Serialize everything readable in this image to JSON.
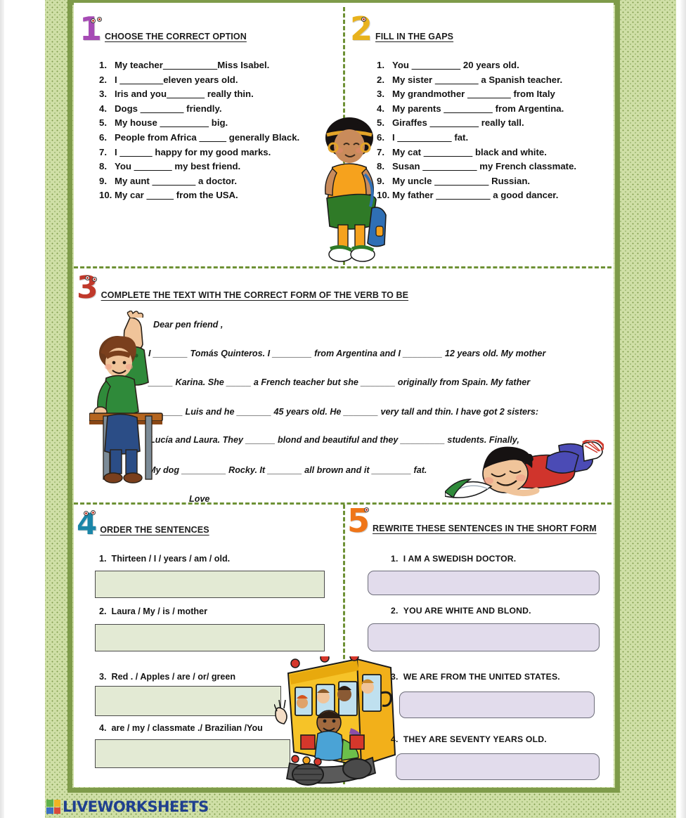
{
  "page": {
    "background_color": "#cfdfa6",
    "border_color": "#7e9b4a",
    "paper_color": "#ffffff",
    "separator_color": "#6e9135"
  },
  "exercises": [
    {
      "number": "1",
      "number_color": "#a64bb5",
      "title": "CHOOSE THE CORRECT OPTION",
      "items": [
        {
          "n": "1.",
          "pre": "My teacher",
          "blank": "__________",
          "post": "Miss Isabel."
        },
        {
          "n": "2.",
          "pre": "I  ",
          "blank": "________",
          "post": "eleven years old."
        },
        {
          "n": "3.",
          "pre": "Iris and you",
          "blank": "_______",
          "post": " really thin."
        },
        {
          "n": "4.",
          "pre": "Dogs ",
          "blank": "________",
          "post": " friendly."
        },
        {
          "n": "5.",
          "pre": "My house ",
          "blank": "_________",
          "post": " big."
        },
        {
          "n": "6.",
          "pre": "People from Africa ",
          "blank": "_____",
          "post": " generally Black."
        },
        {
          "n": "7.",
          "pre": "I ",
          "blank": "______",
          "post": " happy for my good marks."
        },
        {
          "n": "8.",
          "pre": "You ",
          "blank": "_______",
          "post": " my best friend."
        },
        {
          "n": "9.",
          "pre": "My aunt ",
          "blank": "________",
          "post": " a doctor."
        },
        {
          "n": "10.",
          "pre": "My car ",
          "blank": "_____",
          "post": " from the USA."
        }
      ]
    },
    {
      "number": "2",
      "number_color": "#e8b21d",
      "title": "FILL IN THE GAPS",
      "items": [
        {
          "n": "1.",
          "pre": "You ",
          "blank": "_________",
          "post": " 20 years old."
        },
        {
          "n": "2.",
          "pre": "My sister ",
          "blank": "________",
          "post": " a Spanish teacher."
        },
        {
          "n": "3.",
          "pre": "My grandmother ",
          "blank": "________",
          "post": " from Italy"
        },
        {
          "n": "4.",
          "pre": "My parents ",
          "blank": "_________",
          "post": " from Argentina."
        },
        {
          "n": "5.",
          "pre": "Giraffes ",
          "blank": "_________",
          "post": " really tall."
        },
        {
          "n": "6.",
          "pre": "I ",
          "blank": "__________",
          "post": " fat."
        },
        {
          "n": "7.",
          "pre": "My cat ",
          "blank": "_________",
          "post": " black and white."
        },
        {
          "n": "8.",
          "pre": "Susan ",
          "blank": "__________",
          "post": " my French classmate."
        },
        {
          "n": "9.",
          "pre": "My uncle ",
          "blank": "__________",
          "post": " Russian."
        },
        {
          "n": "10.",
          "pre": "My father ",
          "blank": "__________",
          "post": " a  good dancer."
        }
      ]
    },
    {
      "number": "3",
      "number_color": "#c0392b",
      "title": "COMPLETE THE TEXT WITH THE CORRECT FORM OF THE VERB TO BE",
      "letter_lines": [
        "Dear pen friend ,",
        "I _______   Tomás Quinteros.  I ________ from  Argentina and I  ________ 12 years old. My mother",
        "_____   Karina. She _____  a  French teacher but she _______ originally from Spain. My father",
        "_______   Luis  and he _______  45 years old. He _______  very tall and thin. I have got 2 sisters:",
        "Lucía and Laura.  They ______  blond and beautiful and they _________ students. Finally,",
        "My dog _________ Rocky. It _______ all brown and it ________ fat.",
        "Love"
      ]
    },
    {
      "number": "4",
      "number_color": "#1a86a8",
      "title": "ORDER THE SENTENCES",
      "items": [
        {
          "n": "1.",
          "text": "Thirteen /  I  /  years / am / old."
        },
        {
          "n": "2.",
          "text": "Laura  / My / is / mother"
        },
        {
          "n": "3.",
          "text": "Red . / Apples / are / or/ green"
        },
        {
          "n": "4.",
          "text": "are /  my / classmate ./ Brazilian /You"
        }
      ],
      "answer_values": [
        "",
        "",
        "",
        ""
      ],
      "answer_box_color": "#e3ead4"
    },
    {
      "number": "5",
      "number_color": "#ef7518",
      "title": "REWRITE THESE SENTENCES IN THE SHORT FORM",
      "items": [
        {
          "n": "1.",
          "text": "I  AM A SWEDISH DOCTOR."
        },
        {
          "n": "2.",
          "text": "YOU ARE WHITE AND BLOND."
        },
        {
          "n": "3.",
          "text": "WE ARE FROM THE UNITED STATES."
        },
        {
          "n": "4.",
          "text": "THEY ARE SEVENTY YEARS OLD."
        }
      ],
      "answer_values": [
        "",
        "",
        "",
        ""
      ],
      "answer_box_color": "#e2dcec"
    }
  ],
  "footer": {
    "brand": "LIVEWORKSHEETS",
    "brand_color": "#1f3f8f",
    "mark_colors": [
      "#5fb04a",
      "#f0b323",
      "#3b6fc4",
      "#d94b3c"
    ]
  }
}
